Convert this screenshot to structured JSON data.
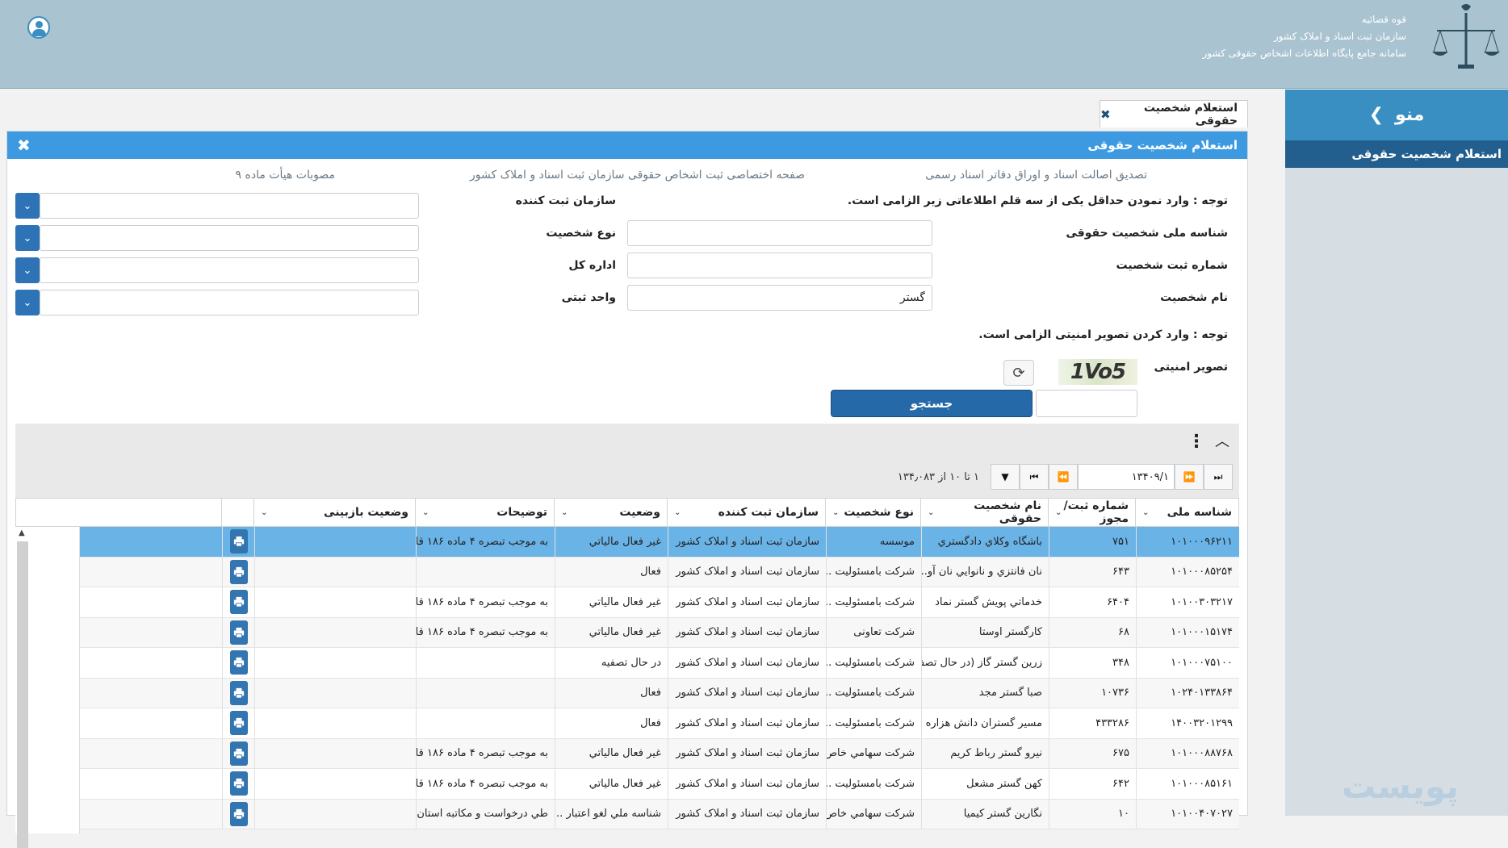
{
  "header": {
    "line1": "قوه قضائیه",
    "line2": "سازمان ثبت اسناد و املاک کشور",
    "line3": "سامانه جامع پایگاه اطلاعات اشخاص حقوقی کشور"
  },
  "sidebar": {
    "menu_label": "منو",
    "items": [
      {
        "label": "استعلام شخصیت حقوقی"
      }
    ]
  },
  "tab": {
    "label": "استعلام شخصیت حقوقی"
  },
  "panel": {
    "title": "استعلام شخصیت حقوقی"
  },
  "links": {
    "link1": "تصدیق اصالت اسناد و اوراق دفاتر اسناد رسمی",
    "link2": "صفحه اختصاصی ثبت اشخاص حقوقی سازمان ثبت اسناد و املاک کشور",
    "link3": "مصوبات هیأت ماده ۹"
  },
  "form": {
    "notice": "توجه : وارد نمودن حداقل یکی از سه قلم اطلاعاتی زیر الزامی است.",
    "national_id_label": "شناسه ملی شخصیت حقوقی",
    "reg_no_label": "شماره ثبت شخصیت",
    "name_label": "نام شخصیت",
    "name_value": "گستر",
    "org_label": "سازمان ثبت کننده",
    "type_label": "نوع شخصیت",
    "dept_label": "اداره کل",
    "unit_label": "واحد ثبتی",
    "captcha_notice": "توجه : وارد کردن تصویر امنیتی الزامی است.",
    "captcha_label": "تصویر امنیتی",
    "captcha_text": "1Vo5",
    "search_label": "جستجو"
  },
  "pager": {
    "page_value": "۱",
    "total_pages": "/۱۳۴۰۹",
    "info": "۱ تا ۱۰ از ۱۳۴٫۰۸۳"
  },
  "table": {
    "headers": [
      "شناسه ملی",
      "شماره ثبت/ مجوز",
      "نام شخصیت حقوقی",
      "نوع شخصیت",
      "سازمان ثبت کننده",
      "وضعیت",
      "توضیحات",
      "وضعیت بازبینی"
    ],
    "rows": [
      [
        "۱۰۱۰۰۰۹۶۲۱۱",
        "۷۵۱",
        "باشگاه وكلاي دادگستري",
        "موسسه",
        "سازمان ثبت اسناد و املاک کشور",
        "غير فعال مالياتي",
        "به موجب تبصره ۴ ماده ۱۸۶ قا...",
        ""
      ],
      [
        "۱۰۱۰۰۰۸۵۲۵۴",
        "۶۴۳",
        "نان فانتزي و نانوايي نان آو...",
        "شرکت بامسئولیت ...",
        "سازمان ثبت اسناد و املاک کشور",
        "فعال",
        "",
        ""
      ],
      [
        "۱۰۱۰۰۳۰۳۲۱۷",
        "۶۴۰۴",
        "خدماتي پويش گستر نماد",
        "شرکت بامسئولیت ...",
        "سازمان ثبت اسناد و املاک کشور",
        "غير فعال مالياتي",
        "به موجب تبصره ۴ ماده ۱۸۶ قا...",
        ""
      ],
      [
        "۱۰۱۰۰۰۱۵۱۷۴",
        "۶۸",
        "كارگستر اوستا",
        "شرکت تعاونی",
        "سازمان ثبت اسناد و املاک کشور",
        "غير فعال مالياتي",
        "به موجب تبصره ۴ ماده ۱۸۶ قا...",
        ""
      ],
      [
        "۱۰۱۰۰۰۷۵۱۰۰",
        "۳۴۸",
        "زرين گستر گاز (در حال تصف...",
        "شرکت بامسئولیت ...",
        "سازمان ثبت اسناد و املاک کشور",
        "در حال تصفيه",
        "",
        ""
      ],
      [
        "۱۰۲۴۰۱۳۳۸۶۴",
        "۱۰۷۳۶",
        "صبا گستر مجد",
        "شرکت بامسئولیت ...",
        "سازمان ثبت اسناد و املاک کشور",
        "فعال",
        "",
        ""
      ],
      [
        "۱۴۰۰۳۲۰۱۲۹۹",
        "۴۳۳۲۸۶",
        "مسير گستران دانش هزاره ...",
        "شرکت بامسئولیت ...",
        "سازمان ثبت اسناد و املاک کشور",
        "فعال",
        "",
        ""
      ],
      [
        "۱۰۱۰۰۰۸۸۷۶۸",
        "۶۷۵",
        "نيرو گستر رباط كريم",
        "شرکت سهامي خاص",
        "سازمان ثبت اسناد و املاک کشور",
        "غير فعال مالياتي",
        "به موجب تبصره ۴ ماده ۱۸۶ قا...",
        ""
      ],
      [
        "۱۰۱۰۰۰۸۵۱۶۱",
        "۶۴۲",
        "كهن گستر مشعل",
        "شرکت بامسئولیت ...",
        "سازمان ثبت اسناد و املاک کشور",
        "غير فعال مالياتي",
        "به موجب تبصره ۴ ماده ۱۸۶ قا...",
        ""
      ],
      [
        "۱۰۱۰۰۴۰۷۰۲۷",
        "۱۰",
        "نگارين گستر كيميا",
        "شرکت سهامي خاص",
        "سازمان ثبت اسناد و املاک کشور",
        "شناسه ملي لغو اعتبار ...",
        "طي درخواست و مكاتبه استان...",
        ""
      ]
    ]
  },
  "watermark": "پویست"
}
